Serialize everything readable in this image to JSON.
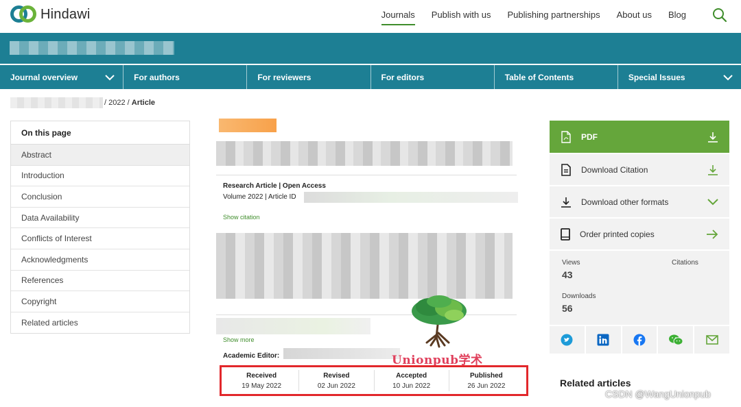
{
  "brand": {
    "name": "Hindawi"
  },
  "top_nav": [
    {
      "label": "Journals",
      "active": true
    },
    {
      "label": "Publish with us"
    },
    {
      "label": "Publishing partnerships"
    },
    {
      "label": "About us"
    },
    {
      "label": "Blog"
    }
  ],
  "journal_nav": [
    {
      "label": "Journal overview",
      "has_menu": true
    },
    {
      "label": "For authors"
    },
    {
      "label": "For reviewers"
    },
    {
      "label": "For editors"
    },
    {
      "label": "Table of Contents"
    },
    {
      "label": "Special Issues",
      "has_menu": true
    }
  ],
  "breadcrumb": {
    "year": "/ 2022 /",
    "current": "Article"
  },
  "toc": {
    "heading": "On this page",
    "items": [
      "Abstract",
      "Introduction",
      "Conclusion",
      "Data Availability",
      "Conflicts of Interest",
      "Acknowledgments",
      "References",
      "Copyright",
      "Related articles"
    ]
  },
  "article": {
    "type": "Research Article | Open Access",
    "volume": "Volume 2022 | Article ID",
    "show_citation": "Show citation",
    "show_more": "Show more",
    "academic_editor": "Academic Editor:"
  },
  "dates": [
    {
      "label": "Received",
      "value": "19 May 2022"
    },
    {
      "label": "Revised",
      "value": "02 Jun 2022"
    },
    {
      "label": "Accepted",
      "value": "10 Jun 2022"
    },
    {
      "label": "Published",
      "value": "26 Jun 2022"
    }
  ],
  "sidebar": {
    "pdf": "PDF",
    "download_citation": "Download Citation",
    "download_formats": "Download other formats",
    "order_printed": "Order printed copies",
    "views_label": "Views",
    "views": "43",
    "citations_label": "Citations",
    "downloads_label": "Downloads",
    "downloads": "56",
    "share_icons": [
      "twitter-icon",
      "linkedin-icon",
      "facebook-icon",
      "wechat-icon",
      "email-icon"
    ]
  },
  "related_heading": "Related articles",
  "watermark": {
    "text": "Unionpub学术"
  },
  "csdn_watermark": "CSDN @WangUnionpub",
  "colors": {
    "teal": "#1d7f94",
    "green": "#65a63b",
    "link_green": "#3f8d2b",
    "highlight_red": "#e2272b"
  }
}
